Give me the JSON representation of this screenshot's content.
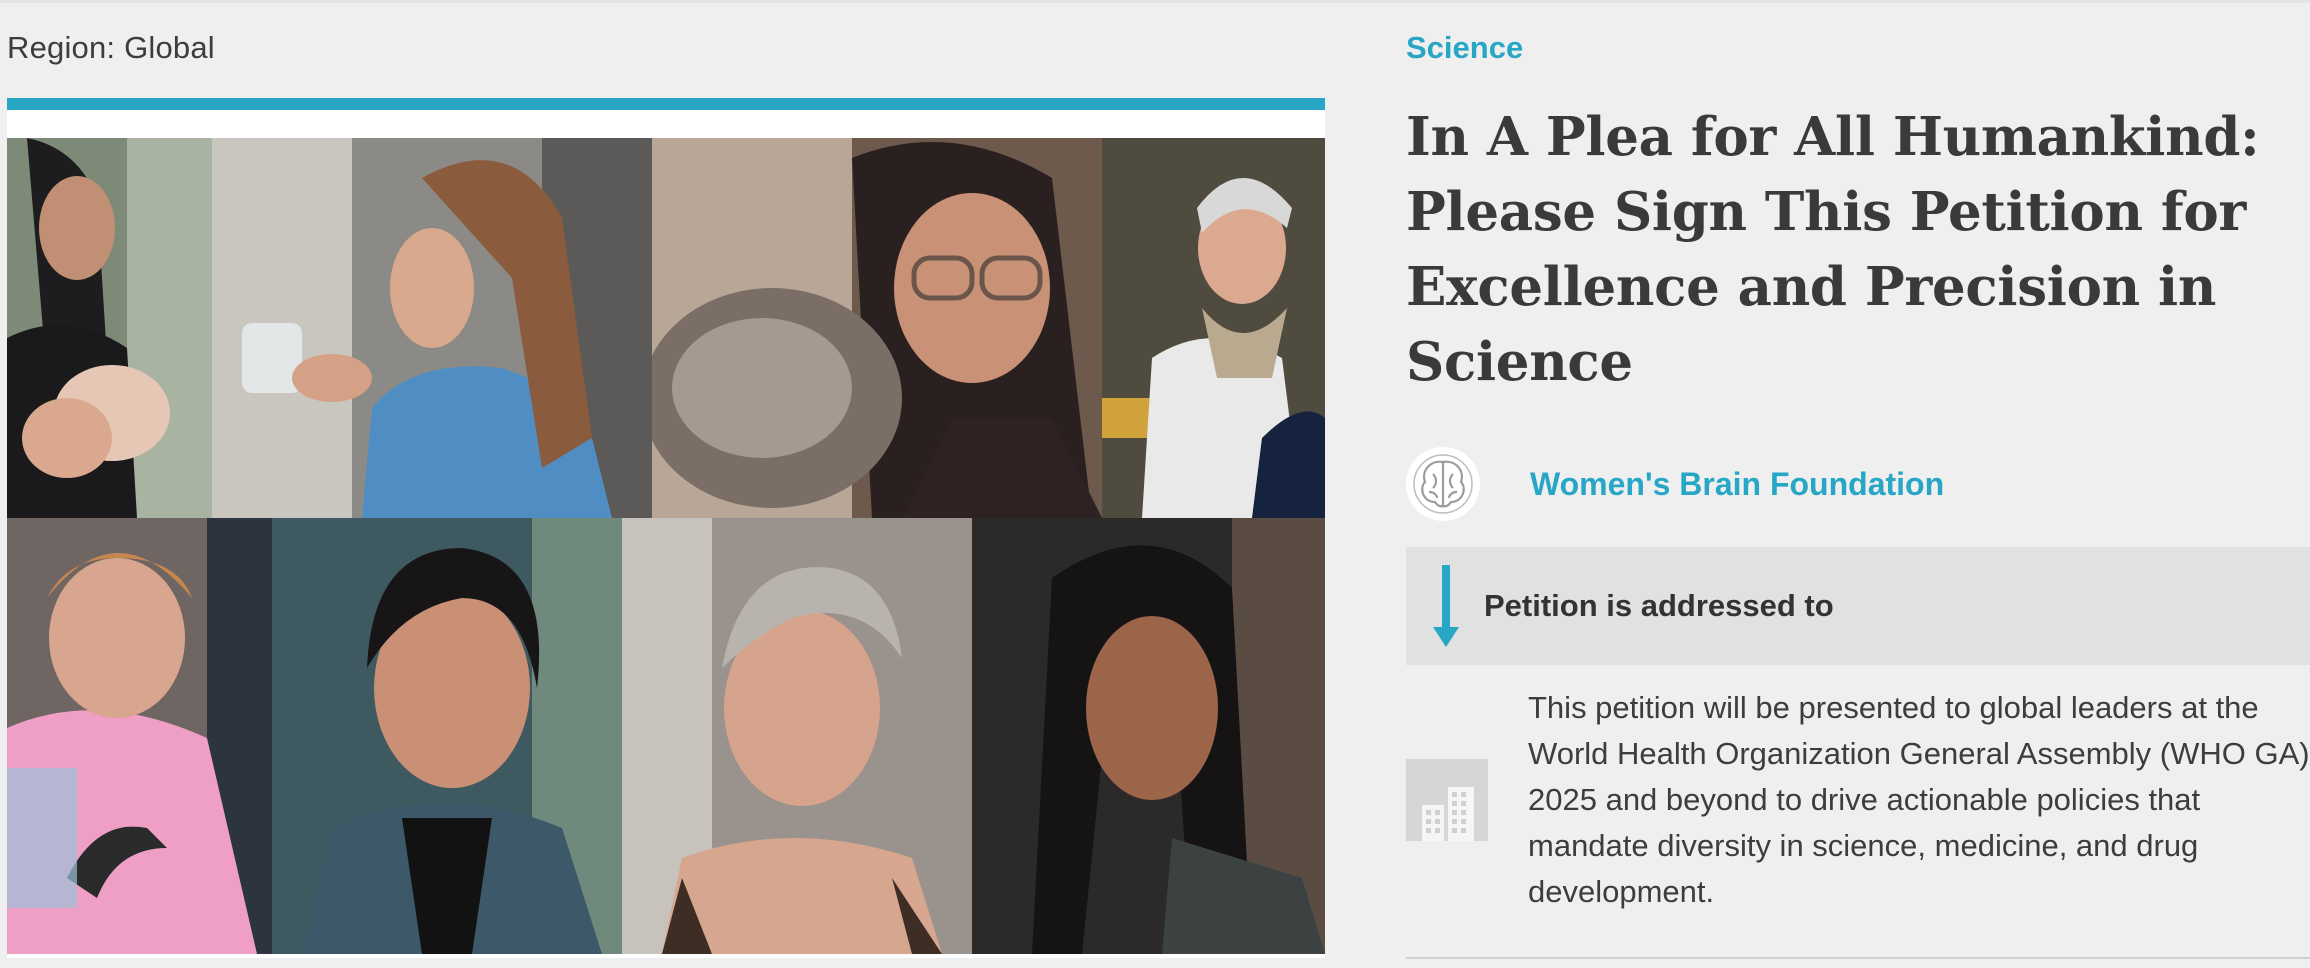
{
  "left": {
    "region_label": "Region: Global",
    "photo": {
      "tiles": [
        {
          "name": "photo-breastfeeding-mother"
        },
        {
          "name": "photo-woman-drinking-water"
        },
        {
          "name": "photo-woman-with-dog"
        },
        {
          "name": "photo-older-woman-scarf"
        },
        {
          "name": "photo-elderly-woman-pink"
        },
        {
          "name": "photo-woman-short-dark-hair"
        },
        {
          "name": "photo-woman-gray-pixie"
        },
        {
          "name": "photo-woman-braids"
        }
      ]
    }
  },
  "right": {
    "category": "Science",
    "title_lines": [
      "In A Plea for All Humankind:",
      "Please Sign This Petition for",
      "Excellence and Precision in",
      "Science"
    ],
    "organization": {
      "name": "Women's Brain Foundation",
      "logo_icon": "brain-icon"
    },
    "addressed": {
      "label": "Petition is addressed to",
      "icon": "arrow-down-icon"
    },
    "recipient": {
      "icon": "building-icon",
      "lines": [
        "This petition will be presented to global leaders at the",
        "World Health Organization General Assembly (WHO GA)",
        "2025 and beyond to drive actionable policies that",
        "mandate diversity in science, medicine, and drug",
        "development."
      ]
    }
  },
  "colors": {
    "accent": "#27a6c6",
    "background": "#efefef",
    "text": "#3a3a3a"
  }
}
